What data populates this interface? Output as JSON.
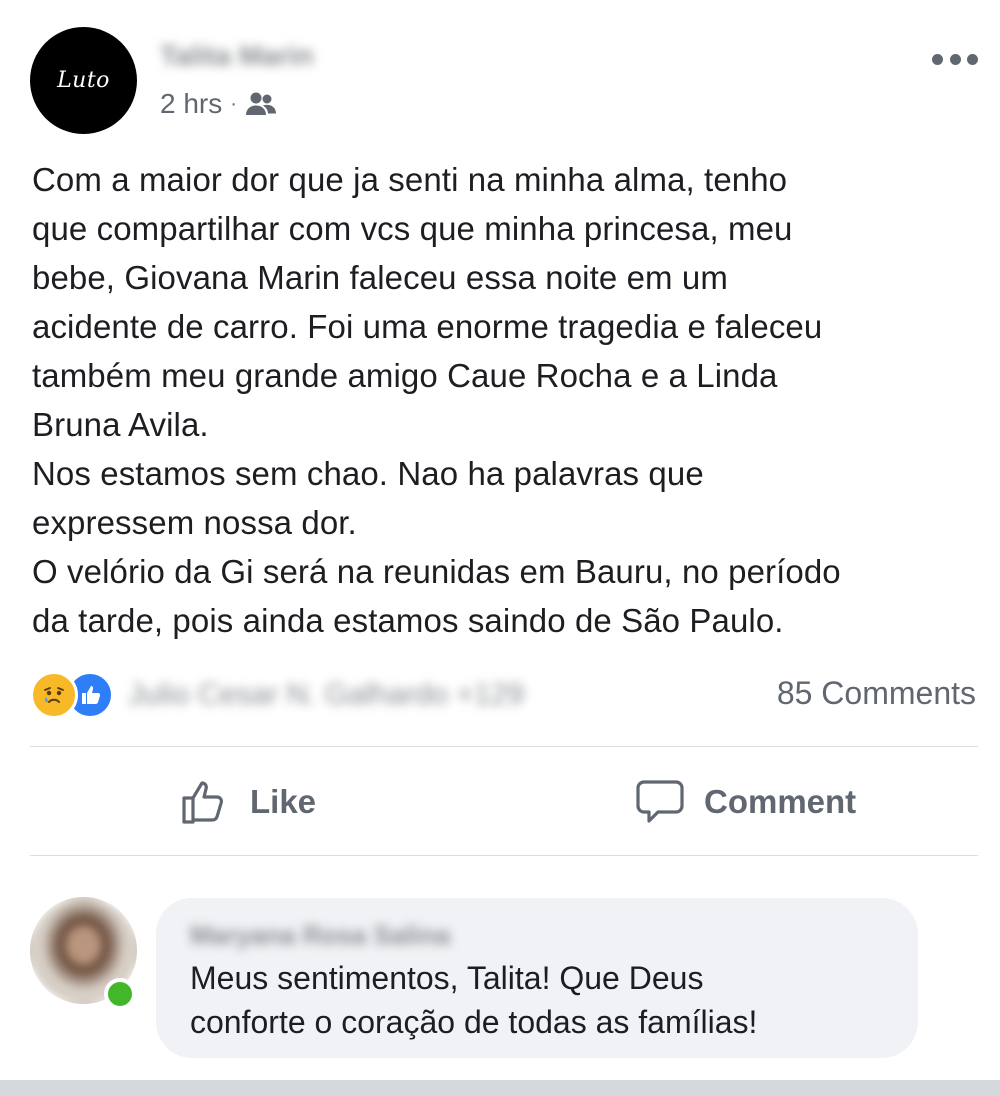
{
  "post": {
    "page_avatar_text": "Luto",
    "author_name": "Talita Marin",
    "timestamp": "2 hrs",
    "separator": "·",
    "audience_icon": "friends-icon",
    "text_lines": [
      "Com a maior dor que ja senti na minha alma, tenho",
      "que compartilhar com vcs que minha princesa, meu",
      "bebe, Giovana Marin faleceu essa noite em um",
      "acidente de carro. Foi uma enorme tragedia e faleceu",
      "também meu grande amigo Caue Rocha e a Linda",
      "Bruna Avila.",
      "Nos estamos sem chao. Nao ha palavras que",
      "expressem nossa dor.",
      "O velório da Gi será na reunidas em Bauru, no período",
      "da tarde, pois ainda estamos saindo de São Paulo."
    ],
    "reactions": {
      "icons": [
        "sad-reaction-icon",
        "like-reaction-icon"
      ],
      "reactors": "Julio Cesar N. Galhardo +129",
      "comments_count": "85 Comments"
    },
    "actions": {
      "like_label": "Like",
      "comment_label": "Comment"
    }
  },
  "comment": {
    "author": "Maryana Rosa Salina",
    "text_lines": [
      "Meus sentimentos, Talita! Que Deus",
      "conforte o coração de todas as famílias!"
    ]
  },
  "colors": {
    "text": "#1c1e21",
    "secondary": "#606770",
    "divider": "#dadde1",
    "comment_bg": "#f0f2f5",
    "like_blue": "#2d7ef7",
    "sad_yellow": "#f7b928",
    "online_green": "#42b72a"
  }
}
